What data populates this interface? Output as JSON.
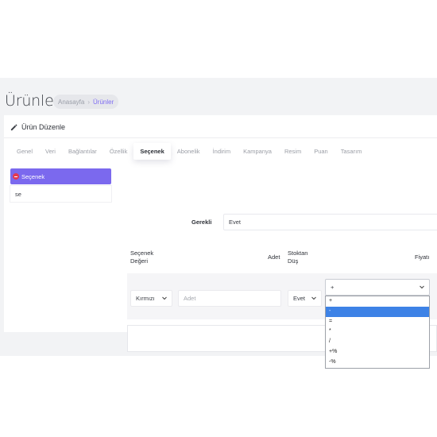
{
  "page": {
    "title": "Ürünler"
  },
  "breadcrumb": {
    "home": "Anasayfa",
    "separator": "›",
    "current": "Ürünler"
  },
  "card": {
    "title": "Ürün Düzenle",
    "title_icon": "pencil-icon"
  },
  "tabs": [
    {
      "label": "Genel",
      "active": false
    },
    {
      "label": "Veri",
      "active": false
    },
    {
      "label": "Bağlantılar",
      "active": false
    },
    {
      "label": "Özellik",
      "active": false
    },
    {
      "label": "Seçenek",
      "active": true
    },
    {
      "label": "Abonelik",
      "active": false
    },
    {
      "label": "İndirim",
      "active": false
    },
    {
      "label": "Kampanya",
      "active": false
    },
    {
      "label": "Resim",
      "active": false
    },
    {
      "label": "Puan",
      "active": false
    },
    {
      "label": "Tasarım",
      "active": false
    }
  ],
  "sidebar": {
    "active_item": "Seçenek",
    "remove_icon": "minus-circle-icon",
    "input_value": "se"
  },
  "form": {
    "required_label": "Gerekli",
    "required_value": "Evet"
  },
  "table": {
    "headers": {
      "option_value": [
        "Seçenek",
        "Değeri"
      ],
      "quantity": "Adet",
      "subtract_stock": [
        "Stoktan",
        "Düş"
      ],
      "price": "Fiyatı"
    },
    "row": {
      "option_value": "Kırmızı",
      "quantity_placeholder": "Adet",
      "subtract_stock": "Evet",
      "price_prefix": "+"
    }
  },
  "price_prefix_dropdown": {
    "options": [
      "+",
      "-",
      "=",
      "*",
      "/",
      "+%",
      "-%"
    ],
    "highlighted_index": 1
  },
  "colors": {
    "accent": "#7b69ee",
    "remove": "#e53950",
    "highlight": "#3d82e6"
  }
}
